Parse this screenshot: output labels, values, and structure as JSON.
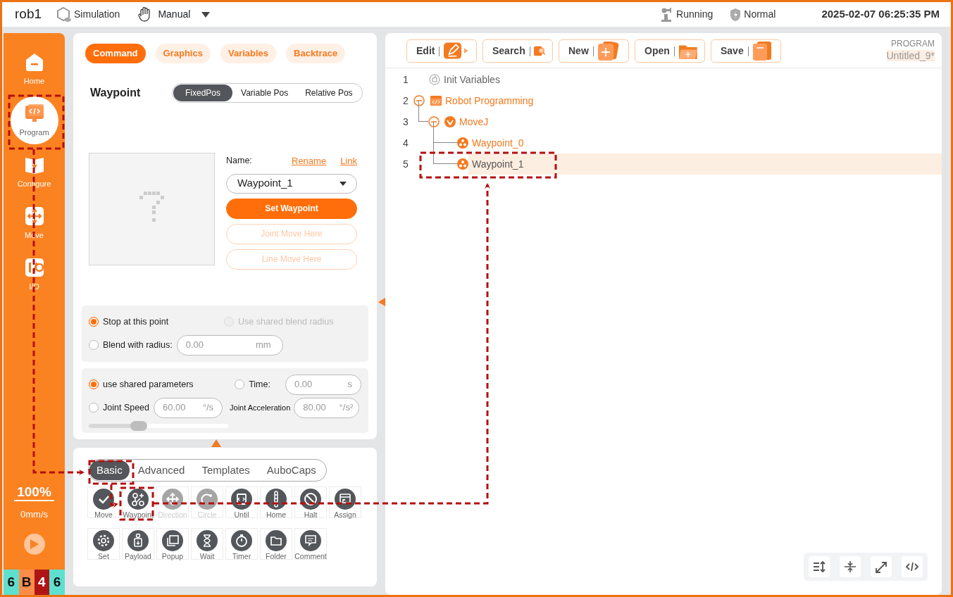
{
  "header": {
    "robot": "rob1",
    "mode": "Simulation",
    "control": "Manual",
    "status": "Running",
    "safety": "Normal",
    "datetime": "2025-02-07 06:25:35 PM"
  },
  "sidebar": {
    "items": [
      {
        "label": "Home",
        "selected": false
      },
      {
        "label": "Program",
        "selected": true
      },
      {
        "label": "Configure",
        "selected": false
      },
      {
        "label": "Move",
        "selected": false
      },
      {
        "label": "I/O",
        "selected": false
      }
    ],
    "speed": "100%",
    "velocity": "0mm/s",
    "status_cells": [
      {
        "text": "6",
        "color": "#5fe0cf"
      },
      {
        "text": "B",
        "color": "#ff8c4a"
      },
      {
        "text": "4",
        "color": "#b01515"
      },
      {
        "text": "6",
        "color": "#5fe0cf"
      }
    ]
  },
  "command_tabs": [
    {
      "label": "Command",
      "selected": true
    },
    {
      "label": "Graphics",
      "selected": false
    },
    {
      "label": "Variables",
      "selected": false
    },
    {
      "label": "Backtrace",
      "selected": false
    }
  ],
  "waypoint": {
    "title": "Waypoint",
    "position_tabs": [
      {
        "label": "FixedPos",
        "selected": true
      },
      {
        "label": "Variable Pos",
        "selected": false
      },
      {
        "label": "Relative Pos",
        "selected": false
      }
    ],
    "name_label": "Name:",
    "rename": "Rename",
    "link": "Link",
    "name_value": "Waypoint_1",
    "buttons": [
      {
        "label": "Set Waypoint",
        "kind": "primary",
        "disabled": false
      },
      {
        "label": "Joint Move Here",
        "kind": "outline",
        "disabled": true
      },
      {
        "label": "Line Move Here",
        "kind": "outline",
        "disabled": true
      }
    ],
    "blend": [
      {
        "label": "Stop at this point",
        "selected": true,
        "disabled": false
      },
      {
        "label": "Use shared blend radius",
        "selected": false,
        "disabled": true
      },
      {
        "label": "Blend with radius:",
        "selected": false,
        "disabled": false,
        "value": "0.00",
        "unit": "mm"
      }
    ],
    "motion": [
      {
        "label": "use shared parameters",
        "selected": true
      },
      {
        "label": "Time:",
        "selected": false,
        "value": "0.00",
        "unit": "s"
      },
      {
        "label": "Joint Speed",
        "selected": false,
        "value": "60.00",
        "unit": "°/s"
      }
    ],
    "acceleration": {
      "label": "Joint Acceleration",
      "value": "80.00",
      "unit": "°/s²"
    },
    "speed_slider": {
      "level": 0.36
    }
  },
  "palette": {
    "tabs": [
      {
        "label": "Basic",
        "selected": true
      },
      {
        "label": "Advanced",
        "selected": false
      },
      {
        "label": "Templates",
        "selected": false
      },
      {
        "label": "AuboCaps",
        "selected": false
      }
    ],
    "items": [
      {
        "label": "Move",
        "disabled": false
      },
      {
        "label": "Waypoint",
        "disabled": false
      },
      {
        "label": "Direction",
        "disabled": true
      },
      {
        "label": "Circle",
        "disabled": true
      },
      {
        "label": "Until",
        "disabled": false
      },
      {
        "label": "Home",
        "disabled": false
      },
      {
        "label": "Halt",
        "disabled": false
      },
      {
        "label": "Assign",
        "disabled": false
      },
      {
        "label": "Set",
        "disabled": false
      },
      {
        "label": "Payload",
        "disabled": false
      },
      {
        "label": "Popup",
        "disabled": false
      },
      {
        "label": "Wait",
        "disabled": false
      },
      {
        "label": "Timer",
        "disabled": false
      },
      {
        "label": "Folder",
        "disabled": false
      },
      {
        "label": "Comment",
        "disabled": false
      }
    ]
  },
  "program": {
    "toolbar": [
      {
        "label": "Edit"
      },
      {
        "label": "Search"
      },
      {
        "label": "New"
      },
      {
        "label": "Open"
      },
      {
        "label": "Save"
      }
    ],
    "caption": "PROGRAM",
    "name": "Untitled_9*",
    "tree": [
      {
        "line": "1",
        "label": "Init Variables",
        "kind": "init",
        "selected": false
      },
      {
        "line": "2",
        "label": "Robot Programming",
        "kind": "program",
        "selected": false,
        "expanded": true,
        "children": [
          {
            "line": "3",
            "label": "MoveJ",
            "kind": "move",
            "selected": false,
            "expanded": true,
            "children": [
              {
                "line": "4",
                "label": "Waypoint_0",
                "kind": "waypoint",
                "selected": false
              },
              {
                "line": "5",
                "label": "Waypoint_1",
                "kind": "waypoint",
                "selected": true
              }
            ]
          }
        ]
      }
    ]
  }
}
